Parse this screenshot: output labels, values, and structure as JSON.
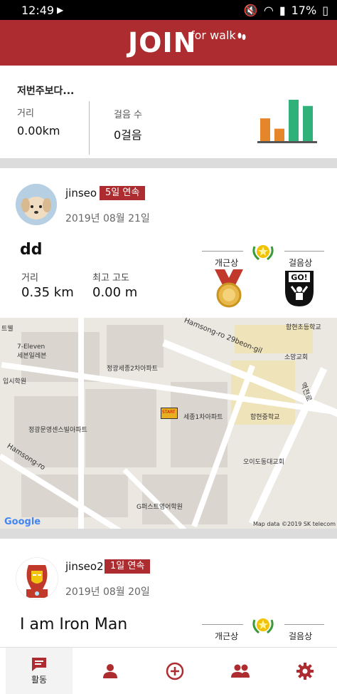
{
  "status": {
    "time": "12:49",
    "battery": "17%"
  },
  "header": {
    "logo": "JOIN",
    "logo_sub": "for walk"
  },
  "summary": {
    "title": "저번주보다...",
    "distance_label": "거리",
    "distance_value": "0.00km",
    "steps_label": "걸음 수",
    "steps_value": "0걸음",
    "chart_bars": [
      {
        "value": 0.55,
        "color": "#e6862b"
      },
      {
        "value": 0.3,
        "color": "#e6862b"
      },
      {
        "value": 1.0,
        "color": "#2fb179"
      },
      {
        "value": 0.85,
        "color": "#2fb179"
      }
    ]
  },
  "posts": [
    {
      "username": "jinseo",
      "streak": "5일 연속",
      "date": "2019년 08월 21일",
      "title": "dd",
      "distance_label": "거리",
      "distance_value": "0.35 km",
      "altitude_label": "최고 고도",
      "altitude_value": "0.00 m",
      "award_attendance": "개근상",
      "award_walking": "걸음상"
    },
    {
      "username": "jinseo2",
      "streak": "1일 연속",
      "date": "2019년 08월 20일",
      "title": "I am Iron Man",
      "award_attendance": "개근상",
      "award_walking": "걸음상"
    }
  ],
  "map": {
    "labels": {
      "l1": "7-Eleven",
      "l2": "세븐일레븐",
      "l3": "입시학원",
      "l4": "정광세종2차아파트",
      "l5": "정광문영센스빌아파트",
      "l6": "세종1차아파트",
      "l7": "함현초등학교",
      "l8": "소망교회",
      "l9": "함현중학교",
      "l10": "오이도동대교회",
      "l11": "G퍼스트영어학원",
      "l12": "Hamsong-ro 29beon-gil",
      "l13": "Hamsong-ro",
      "l14": "역전로",
      "l15": "트웰",
      "l16": "START"
    },
    "google": "Google",
    "credit": "Map data ©2019 SK telecom"
  },
  "tabs": [
    {
      "label": "활동",
      "icon": "activity-icon"
    },
    {
      "label": "",
      "icon": "person-icon"
    },
    {
      "label": "",
      "icon": "add-icon"
    },
    {
      "label": "",
      "icon": "group-icon"
    },
    {
      "label": "",
      "icon": "settings-icon"
    }
  ]
}
